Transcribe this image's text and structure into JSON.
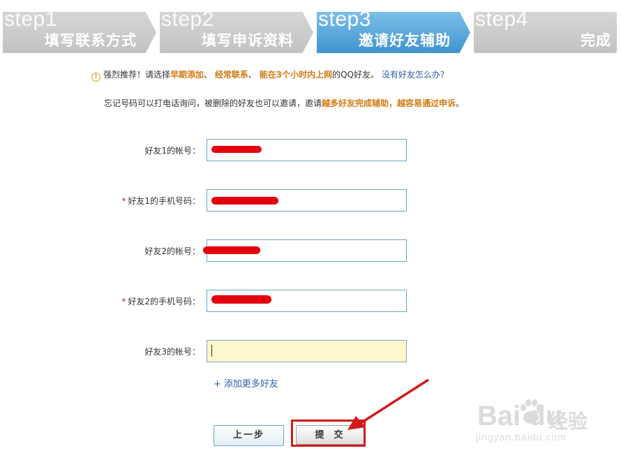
{
  "steps": [
    {
      "num": "step1",
      "label": "填写联系方式",
      "active": false
    },
    {
      "num": "step2",
      "label": "填写申诉资料",
      "active": false
    },
    {
      "num": "step3",
      "label": "邀请好友辅助",
      "active": true
    },
    {
      "num": "step4",
      "label": "完成",
      "active": false
    }
  ],
  "notice": {
    "icon": "warning-icon",
    "prefix": "强烈推荐！请选择",
    "hl1": "早期添加",
    "sep1": "、",
    "hl2": "经常联系",
    "sep2": "、",
    "hl3": "能在3个小时内上网",
    "suffix": "的QQ好友。",
    "link": "没有好友怎么办?"
  },
  "tip": {
    "text": "忘记号码可以打电话询问，被删除的好友也可以邀请，邀请",
    "hl": "越多好友完成辅助，越容易通过申诉",
    "end": "。"
  },
  "form": {
    "friend1_account_label": "好友1的帐号：",
    "friend1_phone_label": "好友1的手机号码：",
    "friend2_account_label": "好友2的帐号：",
    "friend2_phone_label": "好友2的手机号码：",
    "friend3_account_label": "好友3的帐号：",
    "required_mark": "*",
    "add_more": "添加更多好友",
    "add_icon": "+"
  },
  "buttons": {
    "prev": "上一步",
    "submit": "提交"
  },
  "watermark": {
    "logo": "Bai du",
    "cn": "经验",
    "url": "jingyan.baidu.com"
  },
  "colors": {
    "active_step": "#4a9bd4",
    "inactive_step": "#c8c8c8",
    "highlight": "#d07a12",
    "link": "#2c5fa8",
    "annotation_red": "#d11a1a"
  }
}
